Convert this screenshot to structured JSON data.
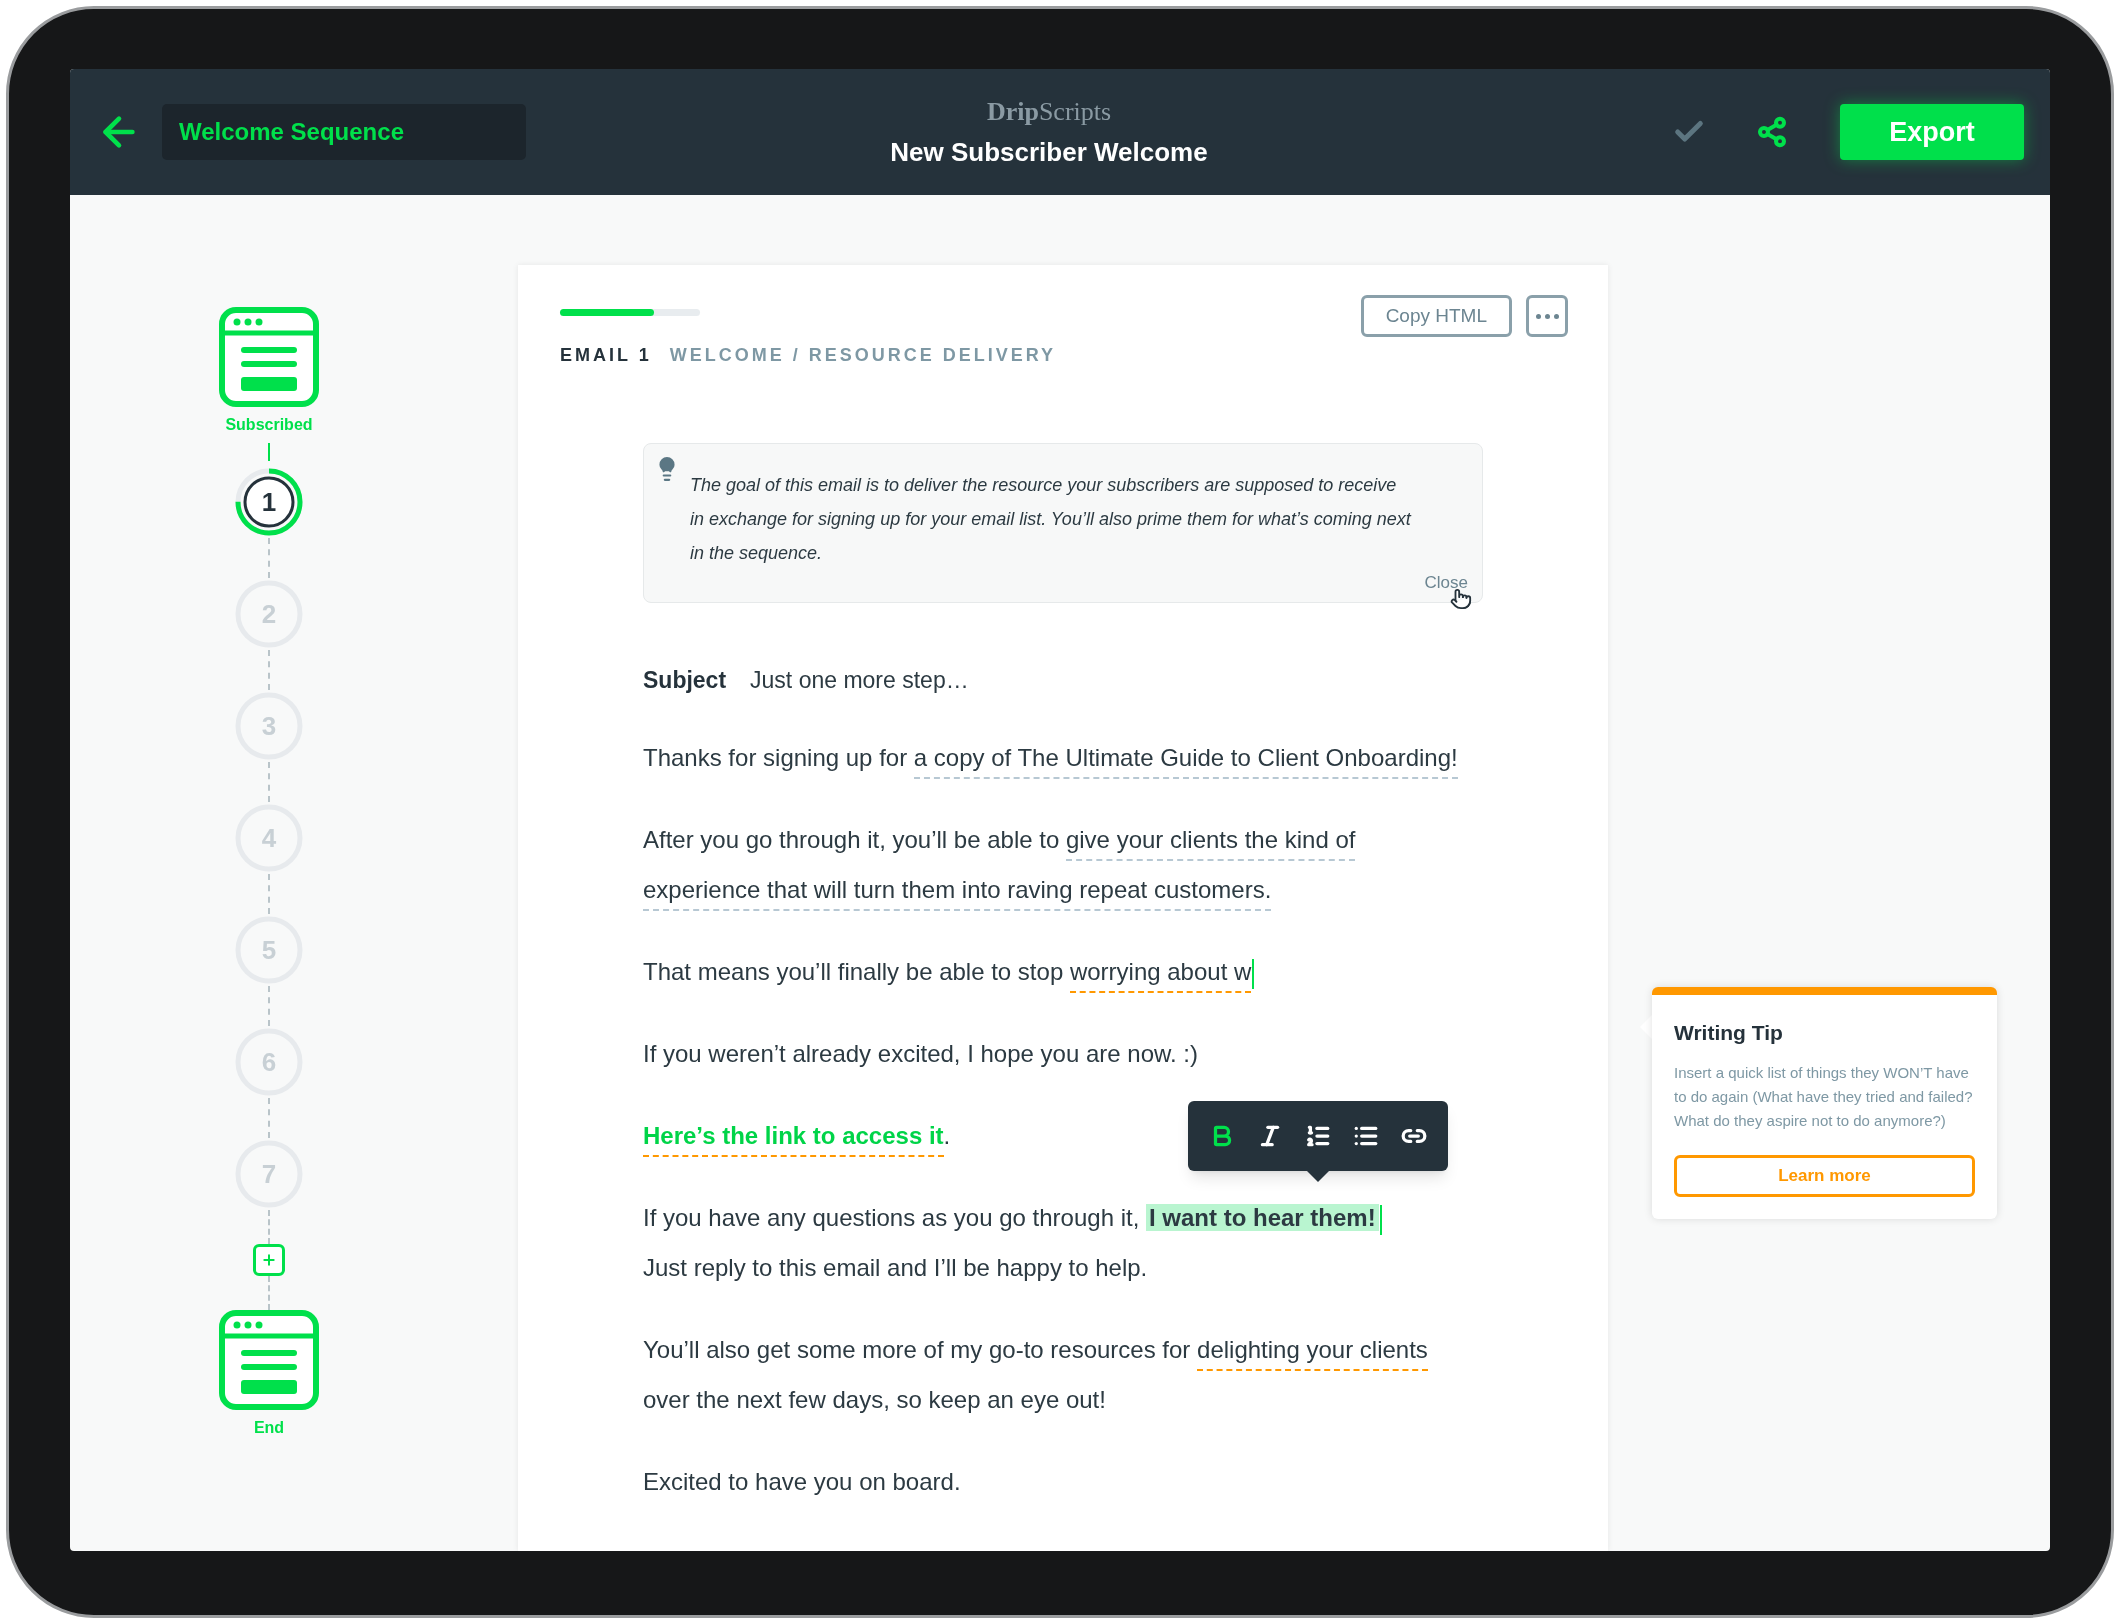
{
  "header": {
    "sequence_name": "Welcome Sequence",
    "brand": "**Drip**Scripts",
    "title": "New Subscriber Welcome",
    "export": "Export"
  },
  "sequence": {
    "start": "Subscribed",
    "end": "End",
    "steps": [
      {
        "label": "1",
        "selected": true,
        "level": 0.75
      },
      {
        "label": "2",
        "selected": false
      },
      {
        "label": "3",
        "selected": false
      },
      {
        "label": "4",
        "selected": false
      },
      {
        "label": "5",
        "selected": false
      },
      {
        "label": "6",
        "selected": false
      },
      {
        "label": "7",
        "selected": false
      }
    ]
  },
  "email": {
    "level": 0.67,
    "number": "EMAIL 1",
    "category": "WELCOME / RESOURCE DELIVERY",
    "copy_button": "Copy HTML",
    "goal": {
      "text": "The goal of this email is to deliver the resource your subscribers are supposed to receive in exchange for signing up for your email list. You’ll also prime them for what’s coming next in the sequence.",
      "close": "Close"
    },
    "subject_label": "Subject",
    "subject": "Just one more step…",
    "paragraphs": [
      {
        "cursor": false,
        "segments": [
          {
            "text": "Thanks for signing up for ",
            "kind": "plain"
          },
          {
            "text": "a copy of The Ultimate Guide to Client Onboarding!",
            "kind": "suggestion"
          }
        ]
      },
      {
        "cursor": false,
        "segments": [
          {
            "text": "After you go through it, you’ll be able to ",
            "kind": "plain"
          },
          {
            "text": "give your clients the kind of experience that will turn them into raving repeat customers.",
            "kind": "suggestion"
          }
        ]
      },
      {
        "cursor": true,
        "segments": [
          {
            "text": "That means you’ll finally be able to stop ",
            "kind": "plain"
          },
          {
            "text": "worrying about w",
            "kind": "warning"
          }
        ]
      },
      {
        "cursor": false,
        "segments": [
          {
            "text": "If you weren’t already excited, I hope you are now. :)",
            "kind": "plain"
          }
        ]
      },
      {
        "cursor": false,
        "segments": [
          {
            "text": "Here’s the link to access it",
            "kind": "link"
          },
          {
            "text": ".",
            "kind": "plain"
          }
        ]
      },
      {
        "cursor": true,
        "segments": [
          {
            "text": "If you have any questions as you go through it, ",
            "kind": "plain"
          },
          {
            "text": "I want to hear them!",
            "kind": "highlight"
          },
          {
            "text": "Just reply to this email and I’ll be happy to help.",
            "kind": "newline"
          }
        ]
      },
      {
        "cursor": false,
        "segments": [
          {
            "text": "You’ll also get some more of my go-to resources for ",
            "kind": "plain"
          },
          {
            "text": "delighting your clients",
            "kind": "warning"
          },
          {
            "text": " over the next few days, so keep an eye out!",
            "kind": "plain"
          }
        ]
      },
      {
        "cursor": false,
        "segments": [
          {
            "text": "Excited to have you on board.",
            "kind": "plain"
          }
        ]
      }
    ]
  },
  "toolbar": [
    {
      "kind": "bold",
      "selected": true
    },
    {
      "kind": "italic",
      "selected": false
    },
    {
      "kind": "numbered",
      "selected": false
    },
    {
      "kind": "bulleted",
      "selected": false
    },
    {
      "kind": "link",
      "selected": false
    }
  ],
  "writing_tip": {
    "title": "Writing Tip",
    "text": "Insert a quick list of things they WON’T have to do again (What have they tried and failed? What do they aspire not to do anymore?)",
    "button": "Learn more"
  }
}
